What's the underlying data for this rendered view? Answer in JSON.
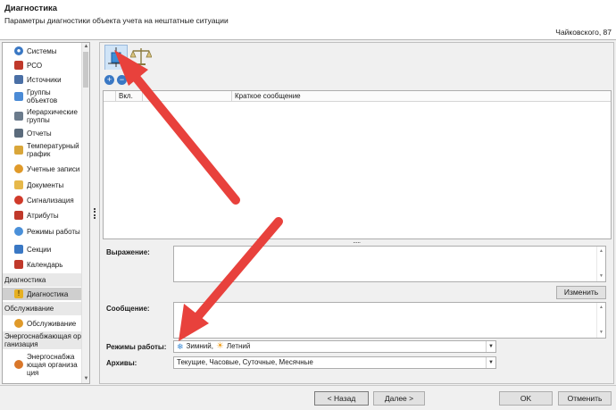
{
  "header": {
    "title": "Диагностика",
    "subtitle": "Параметры диагностики объекта учета на нештатные ситуации",
    "address": "Чайковского, 87"
  },
  "sidebar": {
    "items": [
      {
        "label": "Системы",
        "icon": "location-icon",
        "color": "#3a78c4"
      },
      {
        "label": "РСО",
        "icon": "rso-icon",
        "color": "#c0392b"
      },
      {
        "label": "Источники",
        "icon": "factory-icon",
        "color": "#4a6fa5"
      },
      {
        "label": "Группы объектов",
        "icon": "group-icon",
        "color": "#4b8bd6"
      },
      {
        "label": "Иерархические группы",
        "icon": "hierarchy-icon",
        "color": "#6b7b8c"
      },
      {
        "label": "Отчеты",
        "icon": "report-icon",
        "color": "#5b6b7c"
      },
      {
        "label": "Температурный график",
        "icon": "chart-icon",
        "color": "#d9a63a"
      },
      {
        "label": "Учетные записи",
        "icon": "user-icon",
        "color": "#e09a2a"
      },
      {
        "label": "Документы",
        "icon": "folder-icon",
        "color": "#e6b84a"
      },
      {
        "label": "Сигнализация",
        "icon": "alarm-icon",
        "color": "#d03a2a"
      },
      {
        "label": "Атрибуты",
        "icon": "attributes-icon",
        "color": "#c0392b"
      },
      {
        "label": "Режимы работы",
        "icon": "mode-icon",
        "color": "#4a90d9"
      },
      {
        "label": "Секции",
        "icon": "sections-icon",
        "color": "#3a78c4"
      },
      {
        "label": "Календарь",
        "icon": "calendar-icon",
        "color": "#c0392b"
      }
    ],
    "groups": [
      {
        "label": "Диагностика"
      },
      {
        "label": "Обслуживание"
      },
      {
        "label": "Энергоснабжающая организация"
      }
    ],
    "group_items": [
      {
        "label": "Диагностика",
        "icon": "warning-icon",
        "color": "#e6b022"
      },
      {
        "label": "Обслуживание",
        "icon": "service-icon",
        "color": "#e09a2a"
      },
      {
        "label": "Энергоснабжающая организация",
        "icon": "energy-org-icon",
        "color": "#d9772a"
      }
    ]
  },
  "table": {
    "columns": [
      "Вкл.",
      "Краткое сообщение"
    ]
  },
  "form": {
    "expression_label": "Выражение:",
    "change_button": "Изменить",
    "message_label": "Сообщение:",
    "modes_label": "Режимы работы:",
    "modes_value_winter": "Зимний,",
    "modes_value_summer": "Летний",
    "archives_label": "Архивы:",
    "archives_value": "Текущие, Часовые, Суточные, Месячные"
  },
  "footer": {
    "back": "< Назад",
    "next": "Далее >",
    "ok": "OK",
    "cancel": "Отменить"
  },
  "colors": {
    "annotation_arrow": "#e8413c",
    "active_tab": "#d0e4f7"
  }
}
